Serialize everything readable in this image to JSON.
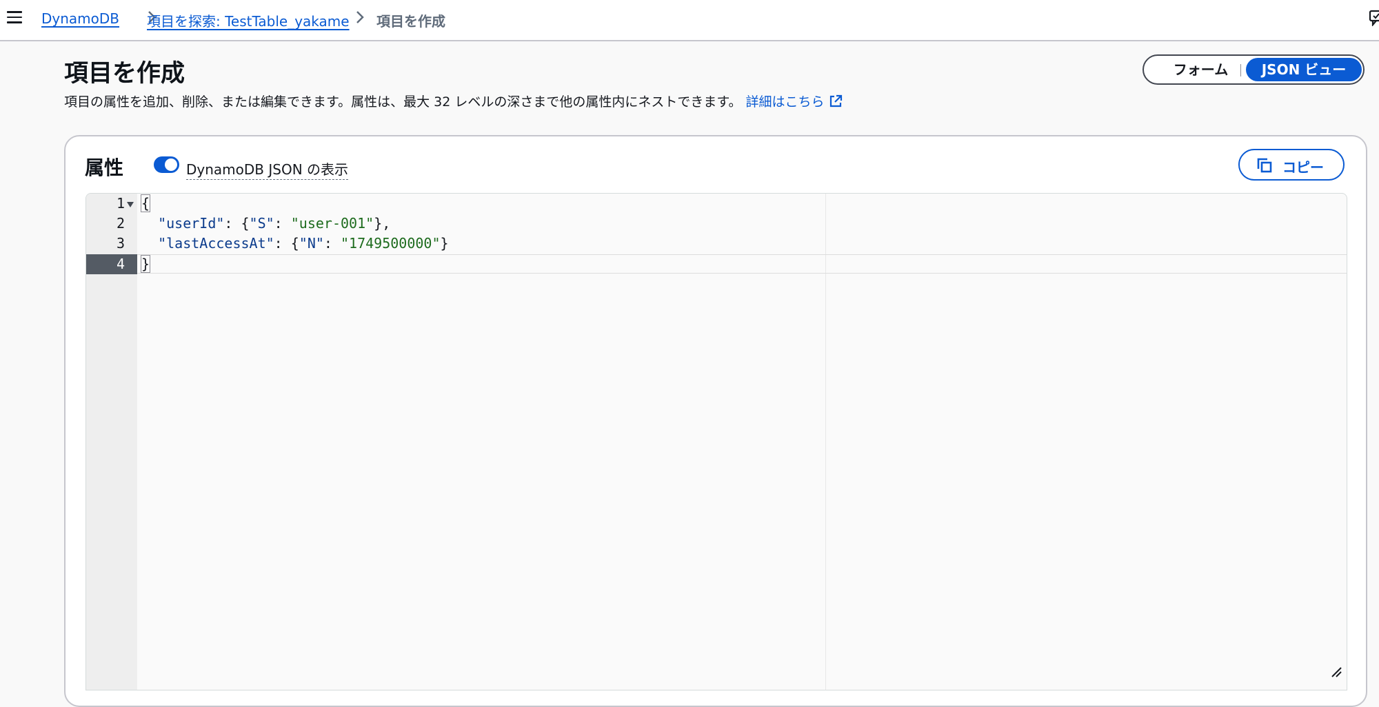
{
  "breadcrumb": {
    "items": [
      {
        "label": "DynamoDB"
      },
      {
        "label": "項目を探索: TestTable_yakame"
      }
    ],
    "current": "項目を作成"
  },
  "page": {
    "title": "項目を作成",
    "description": "項目の属性を追加、削除、または編集できます。属性は、最大 32 レベルの深さまで他の属性内にネストできます。",
    "learn_more": "詳細はこちら"
  },
  "view_toggle": {
    "options": [
      "フォーム",
      "JSON ビュー"
    ],
    "selected": "JSON ビュー"
  },
  "attributes": {
    "title": "属性",
    "dynamodb_json_toggle": {
      "label": "DynamoDB JSON の表示",
      "on": true
    },
    "copy_label": "コピー"
  },
  "editor": {
    "line_numbers": [
      "1",
      "2",
      "3",
      "4"
    ],
    "active_line": "4",
    "lines": [
      "{",
      "  \"userId\": {\"S\": \"user-001\"},",
      "  \"lastAccessAt\": {\"N\": \"1749500000\"}",
      "}"
    ],
    "tokens": {
      "l1": "{",
      "l2_indent": "  ",
      "l2_key": "\"userId\"",
      "l2_p1": ": {",
      "l2_type": "\"S\"",
      "l2_p2": ": ",
      "l2_val": "\"user-001\"",
      "l2_p3": "},",
      "l3_indent": "  ",
      "l3_key": "\"lastAccessAt\"",
      "l3_p1": ": {",
      "l3_type": "\"N\"",
      "l3_p2": ": ",
      "l3_val": "\"1749500000\"",
      "l3_p3": "}",
      "l4": "}"
    }
  },
  "colors": {
    "accent": "#0b5bd3",
    "json_key": "#0b3b8c",
    "json_string": "#1d6b1d",
    "active_gutter": "#545b64"
  }
}
